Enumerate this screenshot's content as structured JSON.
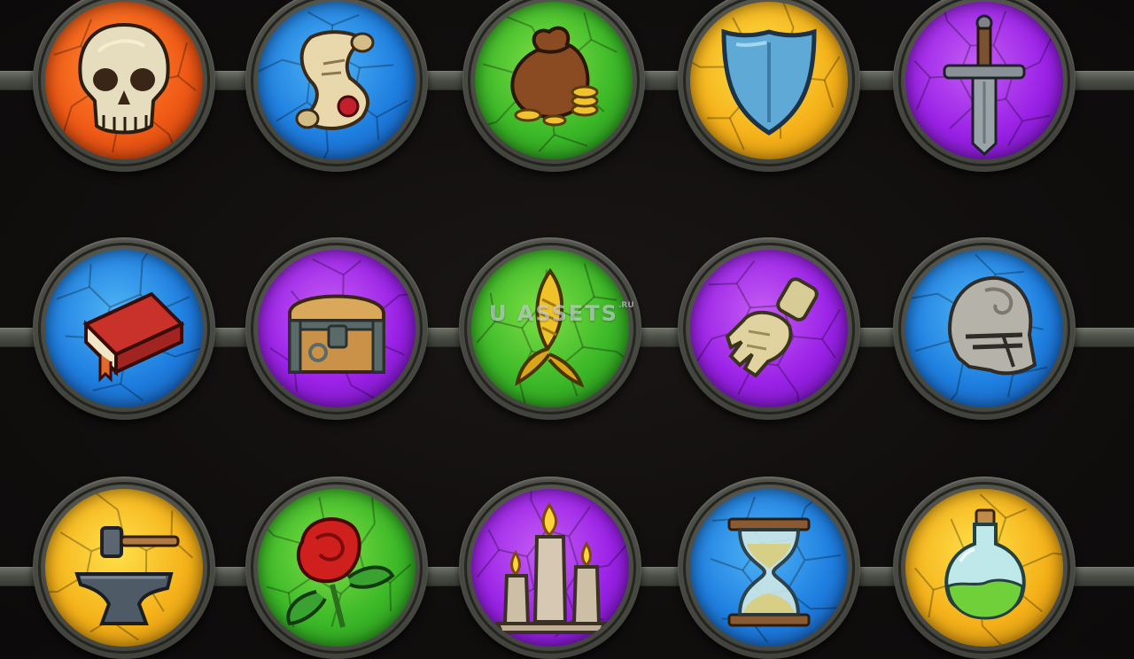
{
  "colors": {
    "background": "#110e0e",
    "rail": "#4d5048",
    "frame": "#4c4e47",
    "orange": "#f05a16",
    "blue": "#1f7fe0",
    "green": "#3cb828",
    "yellow": "#f5b21a",
    "purple": "#9a22e6"
  },
  "watermark": {
    "text": "U ASSETS",
    "suffix": ".RU"
  },
  "icons": [
    {
      "name": "skull-icon",
      "bg": "orange"
    },
    {
      "name": "scroll-icon",
      "bg": "blue"
    },
    {
      "name": "money-bag-icon",
      "bg": "green"
    },
    {
      "name": "shield-icon",
      "bg": "yellow"
    },
    {
      "name": "sword-icon",
      "bg": "purple"
    },
    {
      "name": "book-icon",
      "bg": "blue"
    },
    {
      "name": "treasure-chest-icon",
      "bg": "purple"
    },
    {
      "name": "wheat-icon",
      "bg": "green"
    },
    {
      "name": "gauntlet-icon",
      "bg": "purple"
    },
    {
      "name": "knight-helmet-icon",
      "bg": "blue"
    },
    {
      "name": "anvil-hammer-icon",
      "bg": "yellow"
    },
    {
      "name": "rose-icon",
      "bg": "green"
    },
    {
      "name": "candles-icon",
      "bg": "purple"
    },
    {
      "name": "hourglass-icon",
      "bg": "blue"
    },
    {
      "name": "potion-icon",
      "bg": "yellow"
    }
  ]
}
